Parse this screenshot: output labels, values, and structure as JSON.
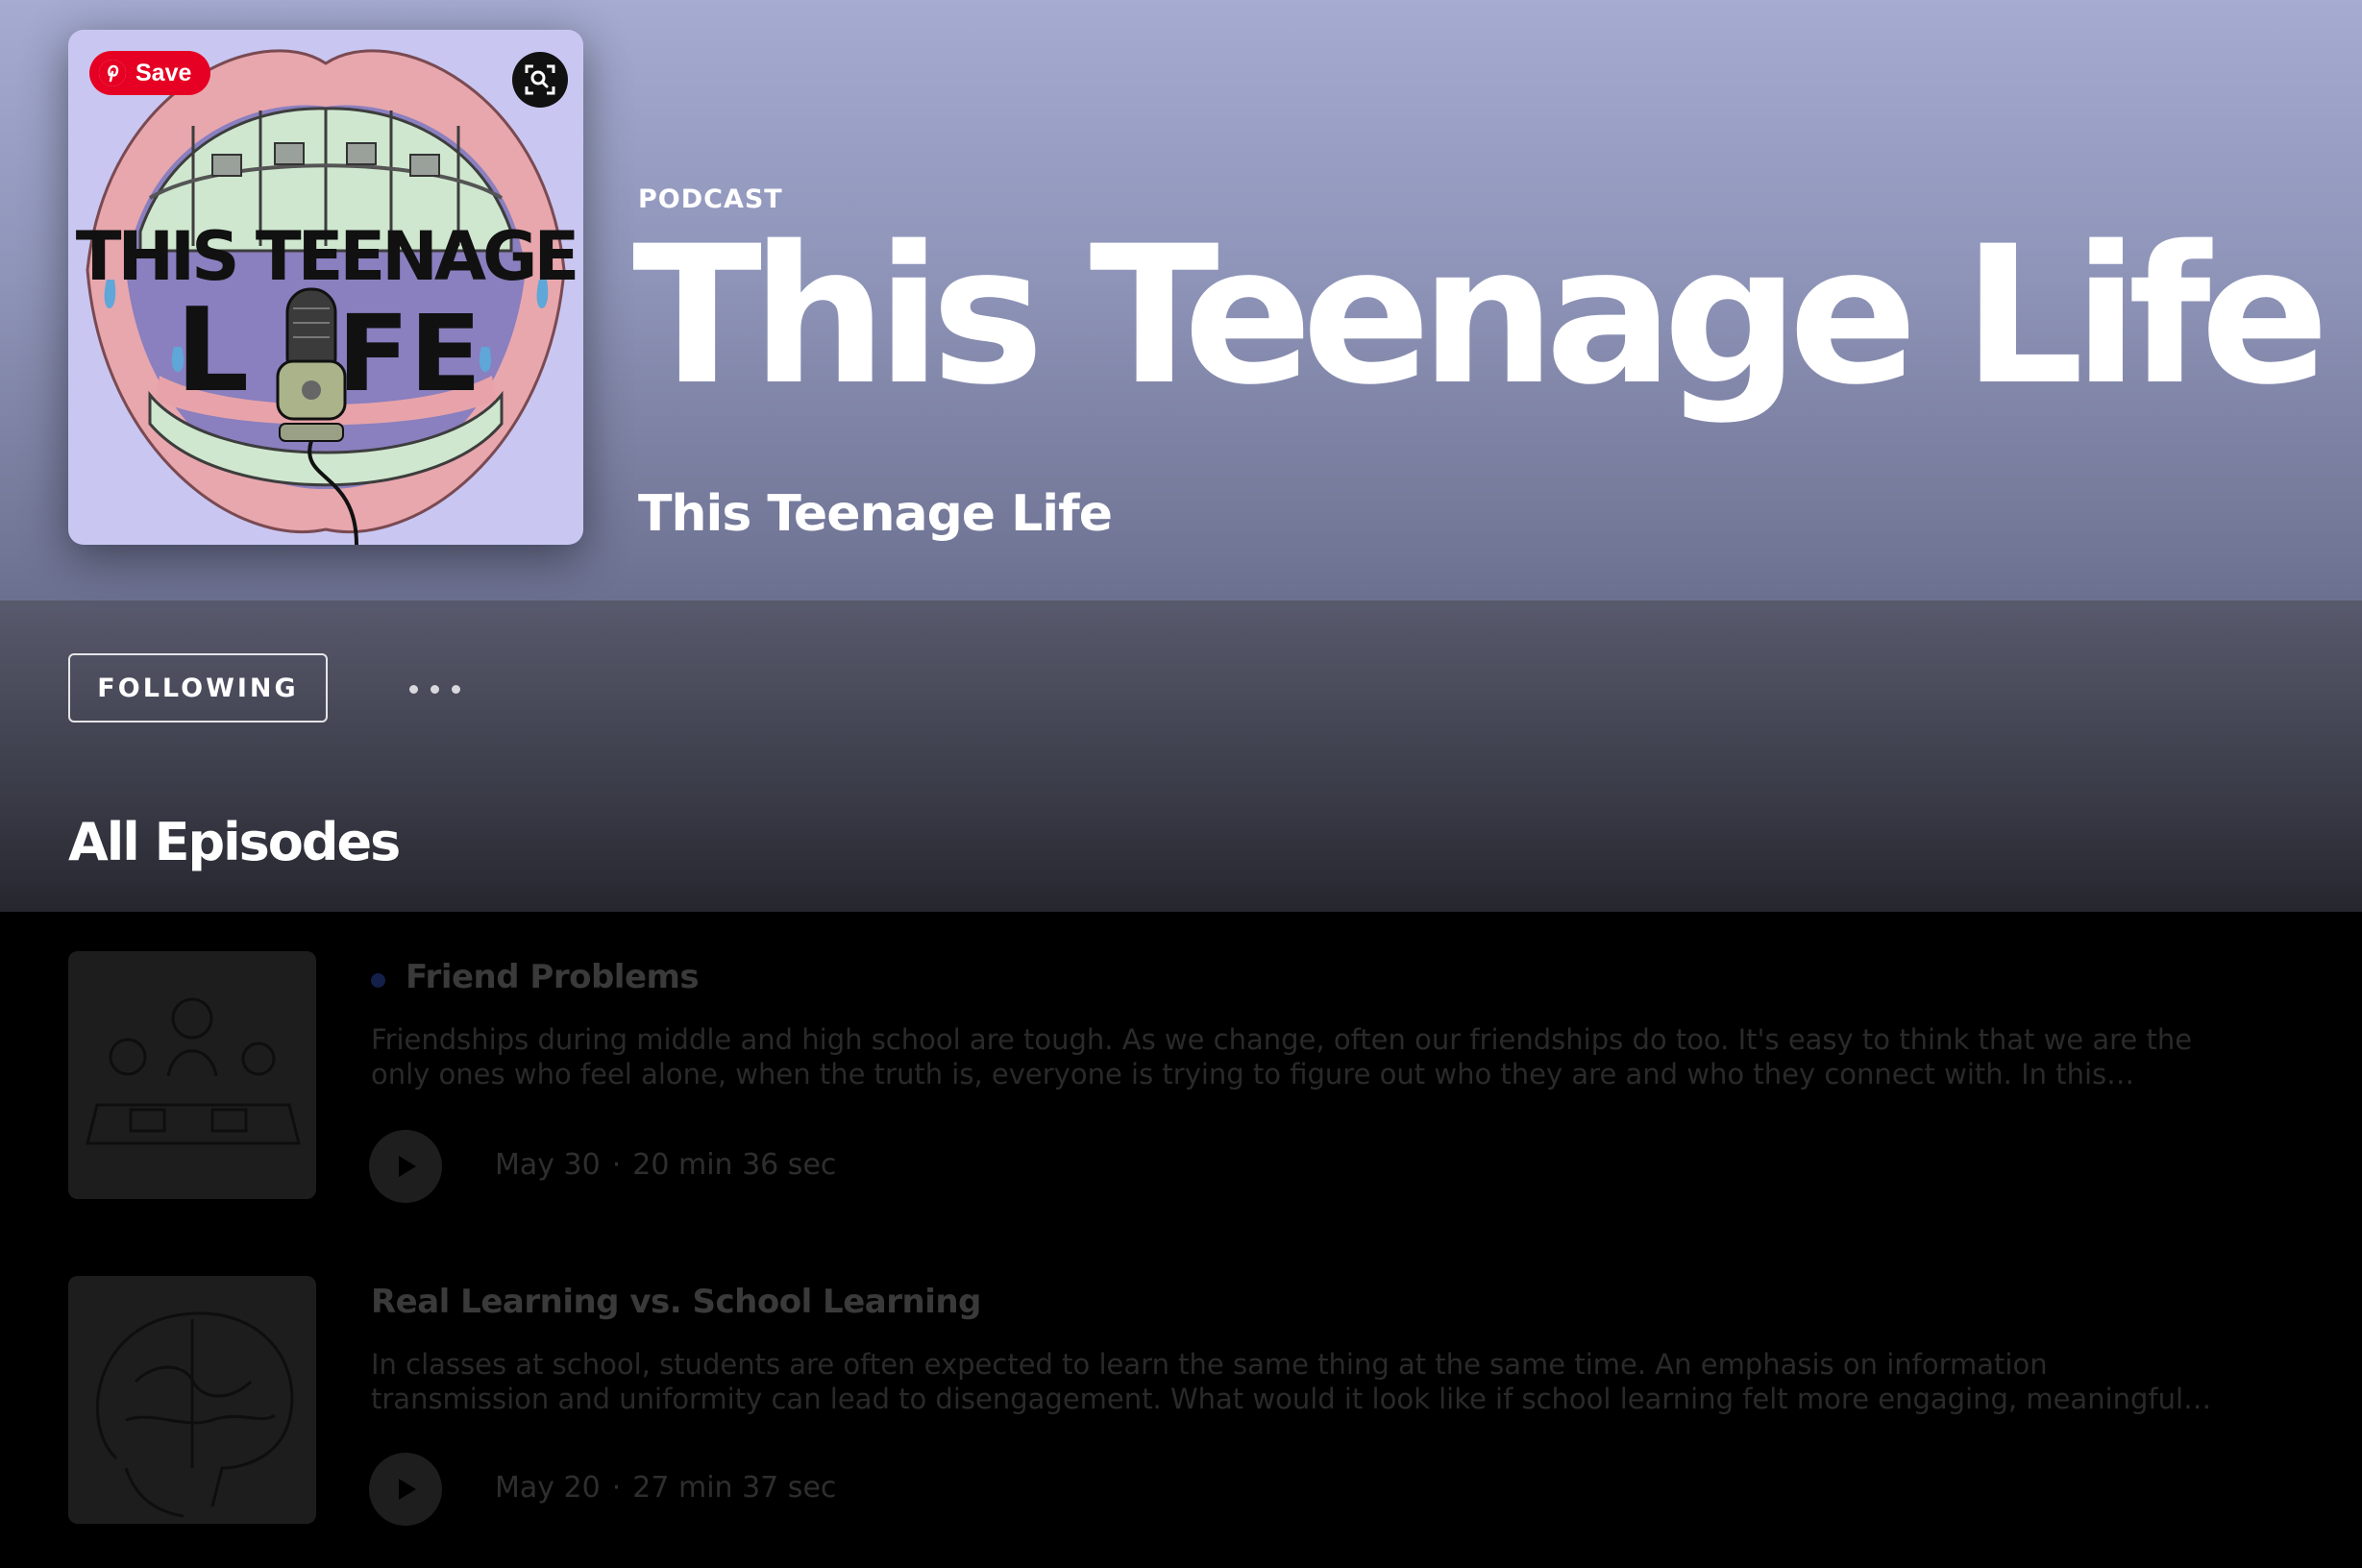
{
  "header": {
    "kind_label": "PODCAST",
    "title": "This Teenage Life",
    "publisher": "This Teenage Life"
  },
  "cover": {
    "art_text_line1": "THIS TEENAGE",
    "art_text_line2_left": "L",
    "art_text_line2_right": "FE",
    "pinterest_save_label": "Save",
    "icons": [
      "pinterest-icon",
      "visual-search-icon"
    ]
  },
  "actions": {
    "follow_label": "FOLLOWING",
    "more_icon": "more-options-icon"
  },
  "section": {
    "title": "All Episodes"
  },
  "episodes": [
    {
      "title": "Friend Problems",
      "unplayed": true,
      "description": "Friendships during middle and high school are tough. As we change, often our friendships do too. It's easy to think that we are the only ones who feel alone, when the truth is, everyone is trying to figure out who they are and who they connect with. In this episod...",
      "date": "May 30",
      "separator": "·",
      "duration": "20 min 36 sec"
    },
    {
      "title": "Real Learning vs. School Learning",
      "unplayed": false,
      "description": "In classes at school, students are often expected to learn the same thing at the same time. An emphasis on information transmission and uniformity can lead to disengagement. What would it look like if school learning felt more engaging, meaningful, relevant, and...",
      "date": "May 20",
      "separator": "·",
      "duration": "27 min 37 sec"
    }
  ],
  "colors": {
    "header_top": "#a5abd1",
    "header_bottom": "#6c7090",
    "band_top": "#585a6d",
    "background": "#000000",
    "cover_bg": "#c9c7f2",
    "pinterest_red": "#e60023",
    "unplayed_dot": "#14204a"
  }
}
